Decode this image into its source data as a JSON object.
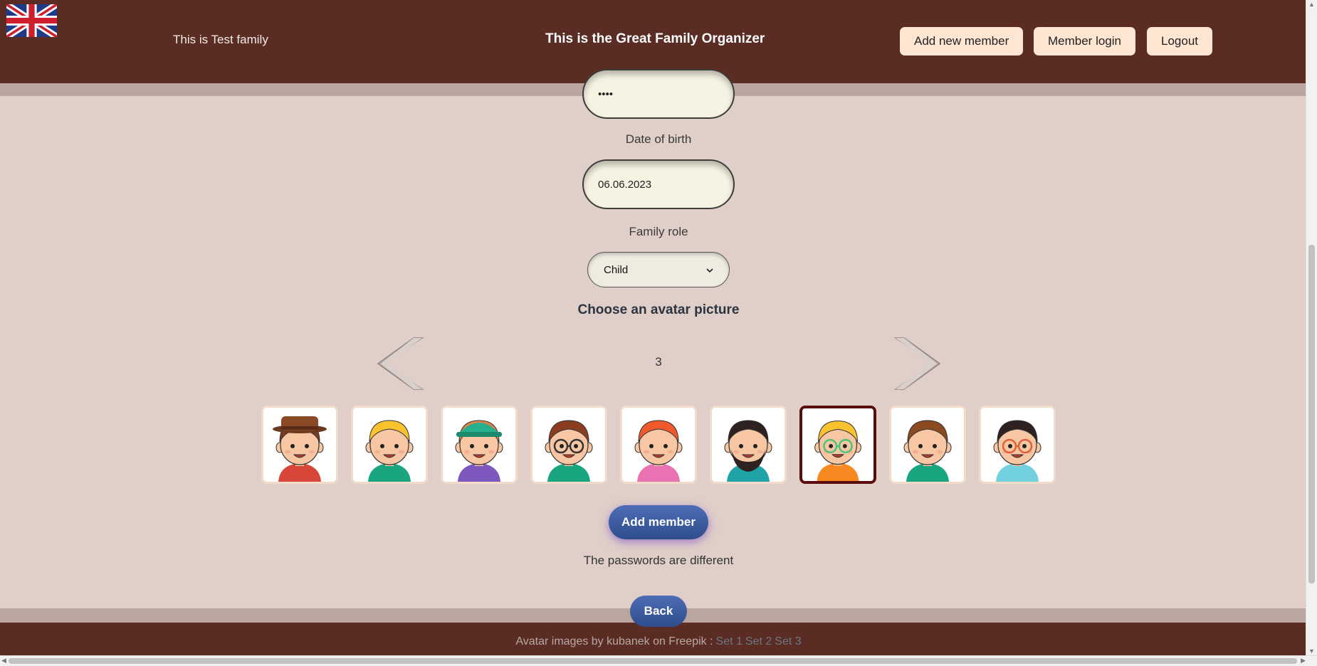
{
  "header": {
    "family_name": "This is Test family",
    "app_title": "This is the Great Family Organizer",
    "add_member_label": "Add new member",
    "member_login_label": "Member login",
    "logout_label": "Logout",
    "language_flag": "uk-flag-icon"
  },
  "form": {
    "password_value": "••••",
    "dob_label": "Date of birth",
    "dob_value": "06.06.2023",
    "role_label": "Family role",
    "role_value": "Child",
    "avatar_title": "Choose an avatar picture",
    "avatar_page": "3",
    "avatars": [
      {
        "name": "avatar-hat-man",
        "hair": "#7a3b22",
        "skin": "#f7c7a3",
        "shirt": "#d8463a",
        "accessory": "hat",
        "selected": false
      },
      {
        "name": "avatar-curly-yellow",
        "hair": "#f9c22e",
        "skin": "#f7c7a3",
        "shirt": "#18a57f",
        "accessory": "none",
        "selected": false
      },
      {
        "name": "avatar-cap-boy",
        "hair": "#e38445",
        "skin": "#f7c7a3",
        "shirt": "#7d58bd",
        "accessory": "cap",
        "selected": false
      },
      {
        "name": "avatar-glasses-woman",
        "hair": "#8b3d1f",
        "skin": "#f7c7a3",
        "shirt": "#18a57f",
        "accessory": "glasses",
        "selected": false
      },
      {
        "name": "avatar-red-hair-woman",
        "hair": "#f0592c",
        "skin": "#f7c7a3",
        "shirt": "#ea71b2",
        "accessory": "none",
        "selected": false
      },
      {
        "name": "avatar-bearded-man",
        "hair": "#2e2220",
        "skin": "#f7c7a3",
        "shirt": "#1fa3a6",
        "accessory": "beard",
        "selected": false
      },
      {
        "name": "avatar-blonde-glasses-boy",
        "hair": "#f9c22e",
        "skin": "#f7c7a3",
        "shirt": "#f6891f",
        "accessory": "green-glasses",
        "selected": true
      },
      {
        "name": "avatar-brown-curly-man",
        "hair": "#8b4a22",
        "skin": "#f7c7a3",
        "shirt": "#18a57f",
        "accessory": "none",
        "selected": false
      },
      {
        "name": "avatar-dark-hair-glasses",
        "hair": "#2e2220",
        "skin": "#f7c7a3",
        "shirt": "#73d0de",
        "accessory": "red-glasses",
        "selected": false
      }
    ],
    "submit_label": "Add member",
    "error_message": "The passwords are different",
    "back_label": "Back"
  },
  "footer": {
    "credit": "Avatar images by kubanek on Freepik :",
    "links": [
      "Set 1",
      "Set 2",
      "Set 3"
    ]
  },
  "colors": {
    "header_bg": "#5a2c24",
    "page_bg": "#dfcfc8",
    "button_bg": "#ffe6d2",
    "primary_blue": "#3b5ba0",
    "selected_border": "#5b0d0d"
  }
}
